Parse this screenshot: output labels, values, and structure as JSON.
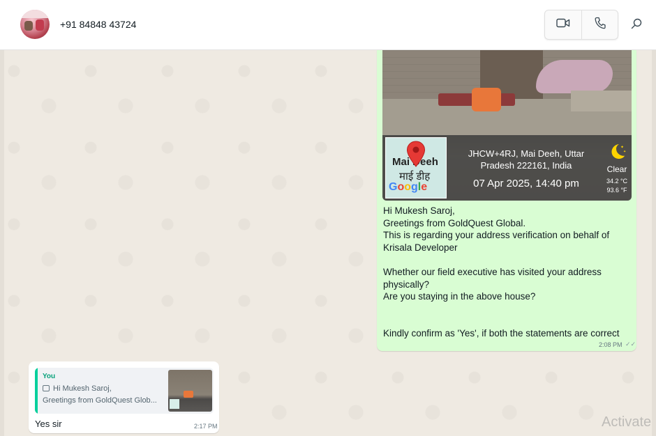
{
  "header": {
    "contact_name": "+91 84848 43724",
    "avatar_icon": "contact-avatar",
    "video_call_icon": "video-camera-icon",
    "voice_call_icon": "phone-icon",
    "search_icon": "search-icon"
  },
  "outgoing_message": {
    "location_stamp": {
      "map_place_en": "Mai Deeh",
      "map_place_hi": "माई डीह",
      "map_brand": "Google",
      "address": "JHCW+4RJ, Mai Deeh, Uttar Pradesh 222161, India",
      "datetime": "07 Apr 2025, 14:40 pm",
      "weather_condition": "Clear",
      "temperature_c": "34.2 °C",
      "temperature_f": "93.6 °F"
    },
    "lines": [
      "Hi Mukesh Saroj,",
      "Greetings from GoldQuest Global.",
      "This is regarding your address verification on behalf of",
      "Krisala Developer",
      "Whether our field executive has visited your address",
      "physically?",
      "Are you staying in the above house?",
      "Kindly confirm as 'Yes', if both the statements are correct"
    ],
    "time": "2:08 PM",
    "status_ticks": "✓✓",
    "bubble_color": "#d9fdd3"
  },
  "incoming_message": {
    "quote_sender": "You",
    "quote_line1": "Hi Mukesh Saroj,",
    "quote_line2": "Greetings from GoldQuest Glob...",
    "text": "Yes sir",
    "time": "2:17 PM"
  },
  "watermark": "Activate",
  "colors": {
    "chat_background": "#efeae2",
    "accent": "#06cf9c"
  }
}
